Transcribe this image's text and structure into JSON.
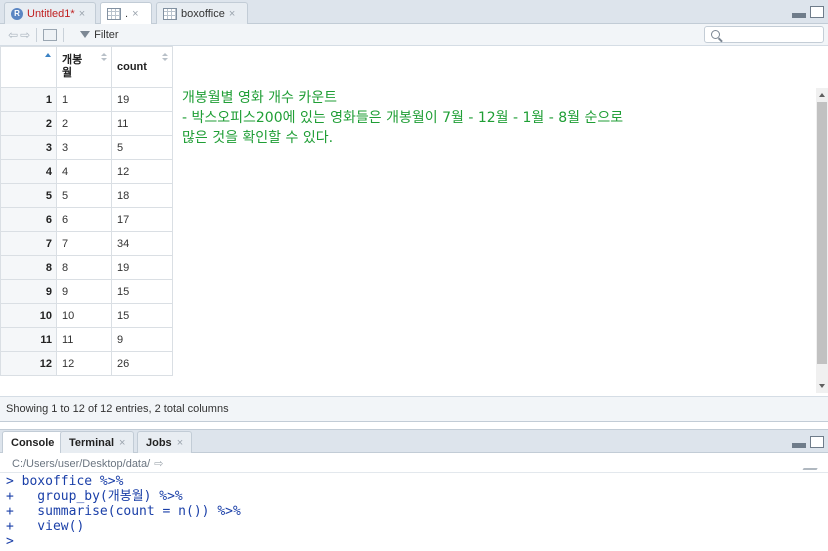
{
  "editor_tabs": [
    {
      "label": "Untitled1*",
      "icon": "r-file-icon",
      "modified": true
    },
    {
      "label": ".",
      "icon": "grid-icon"
    },
    {
      "label": "boxoffice",
      "icon": "grid-icon"
    }
  ],
  "close_glyph": "×",
  "toolbar": {
    "filter_label": "Filter",
    "search_placeholder": ""
  },
  "table": {
    "columns": [
      "개봉\n월",
      "count"
    ],
    "rows": [
      {
        "idx": "1",
        "a": "1",
        "b": "19"
      },
      {
        "idx": "2",
        "a": "2",
        "b": "11"
      },
      {
        "idx": "3",
        "a": "3",
        "b": "5"
      },
      {
        "idx": "4",
        "a": "4",
        "b": "12"
      },
      {
        "idx": "5",
        "a": "5",
        "b": "18"
      },
      {
        "idx": "6",
        "a": "6",
        "b": "17"
      },
      {
        "idx": "7",
        "a": "7",
        "b": "34"
      },
      {
        "idx": "8",
        "a": "8",
        "b": "19"
      },
      {
        "idx": "9",
        "a": "9",
        "b": "15"
      },
      {
        "idx": "10",
        "a": "10",
        "b": "15"
      },
      {
        "idx": "11",
        "a": "11",
        "b": "9"
      },
      {
        "idx": "12",
        "a": "12",
        "b": "26"
      }
    ]
  },
  "note": {
    "line1": "개봉월별 영화 개수 카운트",
    "line2": "- 박스오피스200에 있는 영화들은 개봉월이 7월 - 12월 - 1월 - 8월 순으로",
    "line3": "많은 것을 확인할 수 있다."
  },
  "status": "Showing 1 to 12 of 12 entries, 2 total columns",
  "console_tabs": [
    {
      "label": "Console"
    },
    {
      "label": "Terminal"
    },
    {
      "label": "Jobs"
    }
  ],
  "console_path": "C:/Users/user/Desktop/data/",
  "console_lines": [
    "> boxoffice %>%",
    "+   group_by(개봉월) %>%",
    "+   summarise(count = n()) %>%",
    "+   view()",
    ">"
  ],
  "colors": {
    "note_green": "#1f9e35",
    "console_blue": "#1a3fa8",
    "modified_red": "#c02020"
  }
}
